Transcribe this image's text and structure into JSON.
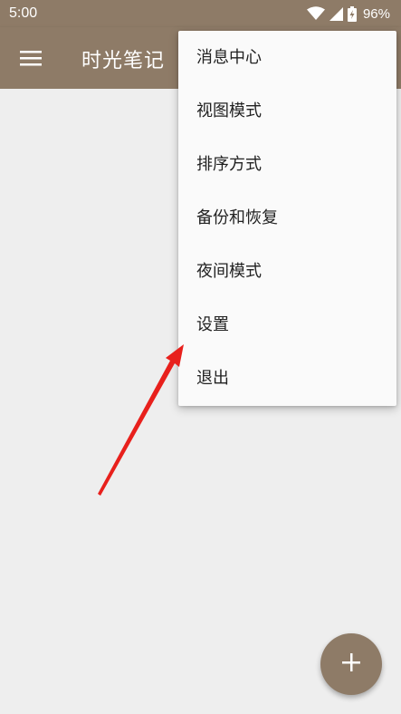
{
  "status_bar": {
    "time": "5:00",
    "battery_percent": "96%",
    "icons": [
      "wifi-icon",
      "signal-icon",
      "battery-charging-icon"
    ]
  },
  "app_bar": {
    "title": "时光笔记",
    "menu_icon": "hamburger-menu-icon"
  },
  "overflow_menu": {
    "items": [
      {
        "label": "消息中心"
      },
      {
        "label": "视图模式"
      },
      {
        "label": "排序方式"
      },
      {
        "label": "备份和恢复"
      },
      {
        "label": "夜间模式"
      },
      {
        "label": "设置"
      },
      {
        "label": "退出"
      }
    ]
  },
  "fab": {
    "icon": "plus-icon"
  },
  "annotation": {
    "icon": "red-arrow-icon",
    "color": "#e8201c"
  },
  "colors": {
    "primary": "#8e7b67",
    "background": "#eeeeee",
    "menu_background": "#fafafa"
  }
}
